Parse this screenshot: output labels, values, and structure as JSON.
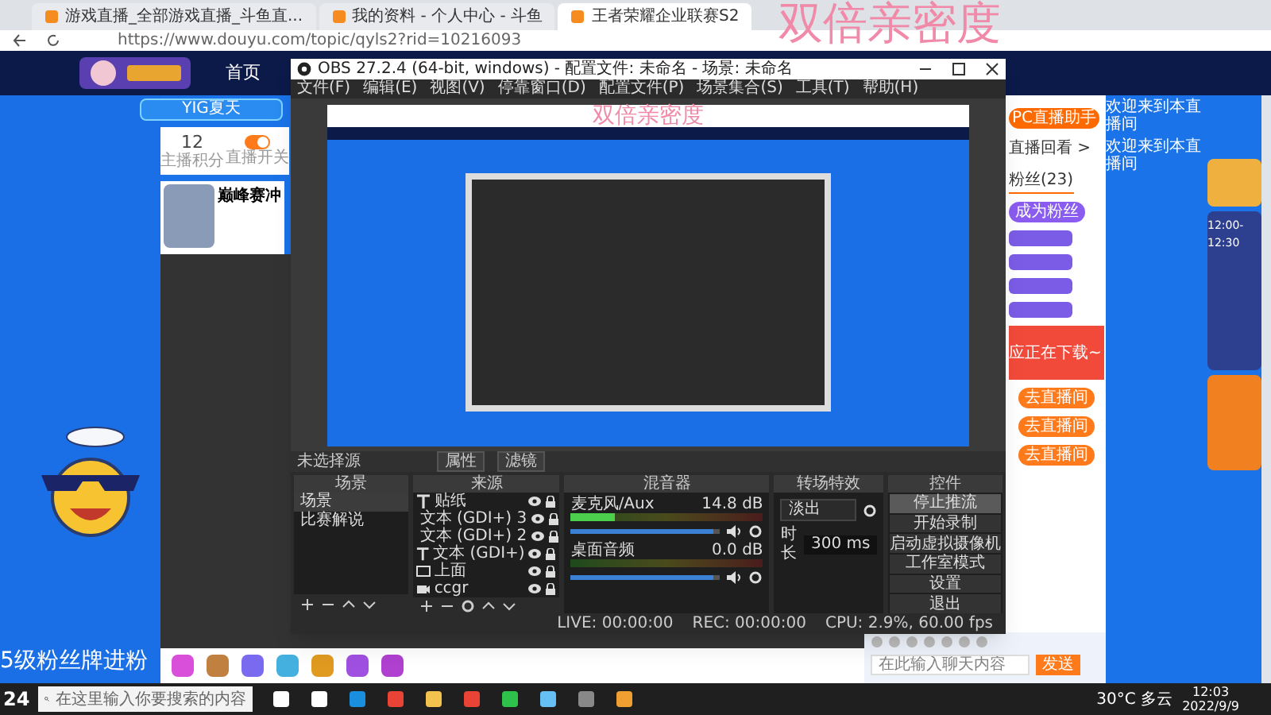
{
  "browser": {
    "tabs": [
      {
        "label": "游戏直播_全部游戏直播_斗鱼直...",
        "selected": false
      },
      {
        "label": "我的资料 - 个人中心 - 斗鱼",
        "selected": false
      },
      {
        "label": "王者荣耀企业联赛S2",
        "selected": true
      }
    ],
    "address": "https://www.douyu.com/topic/qyls2?rid=10216093"
  },
  "overlay_text": "双倍亲密度",
  "site_header": {
    "nav": [
      "首页"
    ]
  },
  "streamer": {
    "name": "YIG夏天",
    "points": "12",
    "points_label": "主播积分",
    "live_switch": {
      "label": "直播开关",
      "on": true
    },
    "video_title": "巅峰赛冲"
  },
  "banner_text": "5级粉丝牌进粉",
  "obs": {
    "title": "OBS 27.2.4 (64-bit, windows) - 配置文件: 未命名 - 场景: 未命名",
    "menu": [
      "文件(F)",
      "编辑(E)",
      "视图(V)",
      "停靠窗口(D)",
      "配置文件(P)",
      "场景集合(S)",
      "工具(T)",
      "帮助(H)"
    ],
    "preview_overlay_text": "双倍亲密度",
    "source_bar": {
      "label": "未选择源",
      "buttons": [
        "属性",
        "滤镜"
      ]
    },
    "scenes": {
      "title": "场景",
      "items": [
        {
          "label": "场景",
          "selected": true
        },
        {
          "label": "比赛解说",
          "selected": false
        }
      ]
    },
    "sources": {
      "title": "来源",
      "items": [
        {
          "label": "贴纸",
          "kind": "text",
          "visible": true
        },
        {
          "label": "文本 (GDI+) 3",
          "kind": "text",
          "visible": true
        },
        {
          "label": "文本 (GDI+) 2",
          "kind": "text",
          "visible": true
        },
        {
          "label": "文本 (GDI+)",
          "kind": "text",
          "visible": true
        },
        {
          "label": "上面",
          "kind": "image",
          "visible": true
        },
        {
          "label": "ccgr",
          "kind": "camera",
          "visible": true
        }
      ]
    },
    "mixer": {
      "title": "混音器",
      "channels": [
        {
          "name": "麦克风/Aux",
          "reading": "14.8 dB",
          "meter": {
            "level": 0.23
          },
          "volume": {
            "level": 0.95
          }
        },
        {
          "name": "桌面音频",
          "reading": "0.0 dB",
          "meter": {
            "level": 0
          },
          "volume": {
            "level": 0.95
          }
        }
      ]
    },
    "transitions": {
      "title": "转场特效",
      "type": "淡出",
      "duration_label": "时长",
      "duration": "300 ms"
    },
    "controls": {
      "title": "控件",
      "buttons": [
        {
          "label": "停止推流",
          "active": true
        },
        {
          "label": "开始录制",
          "active": false
        },
        {
          "label": "启动虚拟摄像机",
          "active": false
        },
        {
          "label": "工作室模式",
          "active": false
        },
        {
          "label": "设置",
          "active": false
        },
        {
          "label": "退出",
          "active": false
        }
      ]
    },
    "status": {
      "live": "LIVE: 00:00:00",
      "rec": "REC: 00:00:00",
      "cpu": "CPU: 2.9%, 60.00 fps"
    }
  },
  "chat": {
    "assistant_button": "PC直播助手",
    "replay_link": "直播回看 >",
    "tabs": [
      {
        "label": "粉丝(23)",
        "selected": true
      }
    ],
    "join_fans_button": "成为粉丝",
    "download_banner": "应正在下载~",
    "room_buttons": [
      "去直播间",
      "去直播间",
      "去直播间"
    ],
    "input": {
      "placeholder": "在此输入聊天内容"
    },
    "send_button": "发送"
  },
  "welcome_lines": [
    "欢迎来到本直播间",
    "欢迎来到本直播间"
  ],
  "ad_time": "12:00-12:30",
  "corner_badge": "24",
  "taskbar": {
    "search": {
      "placeholder": "在这里输入你要搜索的内容"
    },
    "weather": "30°C 多云",
    "time": "12:03",
    "date": "2022/9/9"
  }
}
